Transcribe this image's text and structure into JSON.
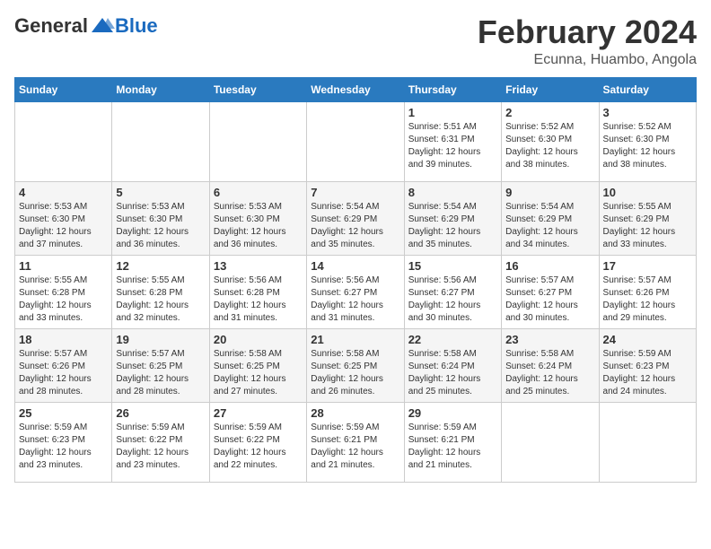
{
  "header": {
    "logo_general": "General",
    "logo_blue": "Blue",
    "month_title": "February 2024",
    "location": "Ecunna, Huambo, Angola"
  },
  "days_of_week": [
    "Sunday",
    "Monday",
    "Tuesday",
    "Wednesday",
    "Thursday",
    "Friday",
    "Saturday"
  ],
  "weeks": [
    [
      {
        "day": "",
        "info": ""
      },
      {
        "day": "",
        "info": ""
      },
      {
        "day": "",
        "info": ""
      },
      {
        "day": "",
        "info": ""
      },
      {
        "day": "1",
        "info": "Sunrise: 5:51 AM\nSunset: 6:31 PM\nDaylight: 12 hours\nand 39 minutes."
      },
      {
        "day": "2",
        "info": "Sunrise: 5:52 AM\nSunset: 6:30 PM\nDaylight: 12 hours\nand 38 minutes."
      },
      {
        "day": "3",
        "info": "Sunrise: 5:52 AM\nSunset: 6:30 PM\nDaylight: 12 hours\nand 38 minutes."
      }
    ],
    [
      {
        "day": "4",
        "info": "Sunrise: 5:53 AM\nSunset: 6:30 PM\nDaylight: 12 hours\nand 37 minutes."
      },
      {
        "day": "5",
        "info": "Sunrise: 5:53 AM\nSunset: 6:30 PM\nDaylight: 12 hours\nand 36 minutes."
      },
      {
        "day": "6",
        "info": "Sunrise: 5:53 AM\nSunset: 6:30 PM\nDaylight: 12 hours\nand 36 minutes."
      },
      {
        "day": "7",
        "info": "Sunrise: 5:54 AM\nSunset: 6:29 PM\nDaylight: 12 hours\nand 35 minutes."
      },
      {
        "day": "8",
        "info": "Sunrise: 5:54 AM\nSunset: 6:29 PM\nDaylight: 12 hours\nand 35 minutes."
      },
      {
        "day": "9",
        "info": "Sunrise: 5:54 AM\nSunset: 6:29 PM\nDaylight: 12 hours\nand 34 minutes."
      },
      {
        "day": "10",
        "info": "Sunrise: 5:55 AM\nSunset: 6:29 PM\nDaylight: 12 hours\nand 33 minutes."
      }
    ],
    [
      {
        "day": "11",
        "info": "Sunrise: 5:55 AM\nSunset: 6:28 PM\nDaylight: 12 hours\nand 33 minutes."
      },
      {
        "day": "12",
        "info": "Sunrise: 5:55 AM\nSunset: 6:28 PM\nDaylight: 12 hours\nand 32 minutes."
      },
      {
        "day": "13",
        "info": "Sunrise: 5:56 AM\nSunset: 6:28 PM\nDaylight: 12 hours\nand 31 minutes."
      },
      {
        "day": "14",
        "info": "Sunrise: 5:56 AM\nSunset: 6:27 PM\nDaylight: 12 hours\nand 31 minutes."
      },
      {
        "day": "15",
        "info": "Sunrise: 5:56 AM\nSunset: 6:27 PM\nDaylight: 12 hours\nand 30 minutes."
      },
      {
        "day": "16",
        "info": "Sunrise: 5:57 AM\nSunset: 6:27 PM\nDaylight: 12 hours\nand 30 minutes."
      },
      {
        "day": "17",
        "info": "Sunrise: 5:57 AM\nSunset: 6:26 PM\nDaylight: 12 hours\nand 29 minutes."
      }
    ],
    [
      {
        "day": "18",
        "info": "Sunrise: 5:57 AM\nSunset: 6:26 PM\nDaylight: 12 hours\nand 28 minutes."
      },
      {
        "day": "19",
        "info": "Sunrise: 5:57 AM\nSunset: 6:25 PM\nDaylight: 12 hours\nand 28 minutes."
      },
      {
        "day": "20",
        "info": "Sunrise: 5:58 AM\nSunset: 6:25 PM\nDaylight: 12 hours\nand 27 minutes."
      },
      {
        "day": "21",
        "info": "Sunrise: 5:58 AM\nSunset: 6:25 PM\nDaylight: 12 hours\nand 26 minutes."
      },
      {
        "day": "22",
        "info": "Sunrise: 5:58 AM\nSunset: 6:24 PM\nDaylight: 12 hours\nand 25 minutes."
      },
      {
        "day": "23",
        "info": "Sunrise: 5:58 AM\nSunset: 6:24 PM\nDaylight: 12 hours\nand 25 minutes."
      },
      {
        "day": "24",
        "info": "Sunrise: 5:59 AM\nSunset: 6:23 PM\nDaylight: 12 hours\nand 24 minutes."
      }
    ],
    [
      {
        "day": "25",
        "info": "Sunrise: 5:59 AM\nSunset: 6:23 PM\nDaylight: 12 hours\nand 23 minutes."
      },
      {
        "day": "26",
        "info": "Sunrise: 5:59 AM\nSunset: 6:22 PM\nDaylight: 12 hours\nand 23 minutes."
      },
      {
        "day": "27",
        "info": "Sunrise: 5:59 AM\nSunset: 6:22 PM\nDaylight: 12 hours\nand 22 minutes."
      },
      {
        "day": "28",
        "info": "Sunrise: 5:59 AM\nSunset: 6:21 PM\nDaylight: 12 hours\nand 21 minutes."
      },
      {
        "day": "29",
        "info": "Sunrise: 5:59 AM\nSunset: 6:21 PM\nDaylight: 12 hours\nand 21 minutes."
      },
      {
        "day": "",
        "info": ""
      },
      {
        "day": "",
        "info": ""
      }
    ]
  ]
}
